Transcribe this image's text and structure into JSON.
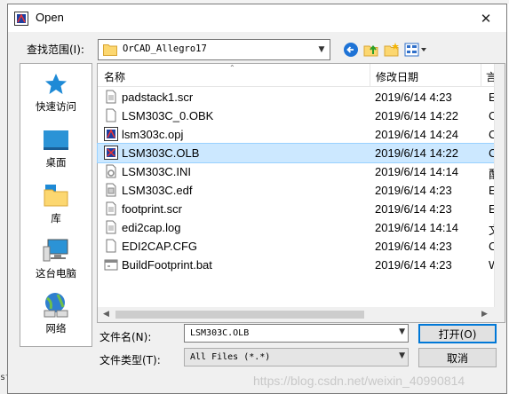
{
  "window": {
    "title": "Open"
  },
  "lookin": {
    "label": "查找范围(I):",
    "value": "OrCAD_Allegro17"
  },
  "places": [
    {
      "label": "快速访问",
      "icon": "star-icon"
    },
    {
      "label": "桌面",
      "icon": "desktop-icon"
    },
    {
      "label": "库",
      "icon": "library-icon"
    },
    {
      "label": "这台电脑",
      "icon": "computer-icon"
    },
    {
      "label": "网络",
      "icon": "network-icon"
    }
  ],
  "list": {
    "headers": {
      "name": "名称",
      "date": "修改日期",
      "type": "言"
    },
    "rows": [
      {
        "name": "padstack1.scr",
        "date": "2019/6/14 4:23",
        "type": "E",
        "icon": "text-file-icon",
        "selected": false
      },
      {
        "name": "LSM303C_0.OBK",
        "date": "2019/6/14 14:22",
        "type": "C",
        "icon": "file-icon",
        "selected": false
      },
      {
        "name": "lsm303c.opj",
        "date": "2019/6/14 14:24",
        "type": "C",
        "icon": "orcad-project-icon",
        "selected": false
      },
      {
        "name": "LSM303C.OLB",
        "date": "2019/6/14 14:22",
        "type": "C",
        "icon": "orcad-library-icon",
        "selected": true
      },
      {
        "name": "LSM303C.INI",
        "date": "2019/6/14 14:14",
        "type": "配",
        "icon": "ini-file-icon",
        "selected": false
      },
      {
        "name": "LSM303C.edf",
        "date": "2019/6/14 4:23",
        "type": "E",
        "icon": "edf-file-icon",
        "selected": false
      },
      {
        "name": "footprint.scr",
        "date": "2019/6/14 4:23",
        "type": "E",
        "icon": "text-file-icon",
        "selected": false
      },
      {
        "name": "edi2cap.log",
        "date": "2019/6/14 14:14",
        "type": "文",
        "icon": "text-file-icon",
        "selected": false
      },
      {
        "name": "EDI2CAP.CFG",
        "date": "2019/6/14 4:23",
        "type": "C",
        "icon": "file-icon",
        "selected": false
      },
      {
        "name": "BuildFootprint.bat",
        "date": "2019/6/14 4:23",
        "type": "W",
        "icon": "batch-file-icon",
        "selected": false
      }
    ]
  },
  "filename": {
    "label": "文件名(N):",
    "value": "LSM303C.OLB"
  },
  "filetype": {
    "label": "文件类型(T):",
    "value": "All Files (*.*)"
  },
  "buttons": {
    "open": "打开(O)",
    "cancel": "取消"
  },
  "left_edge_text": "st",
  "watermark": "https://blog.csdn.net/weixin_40990814"
}
